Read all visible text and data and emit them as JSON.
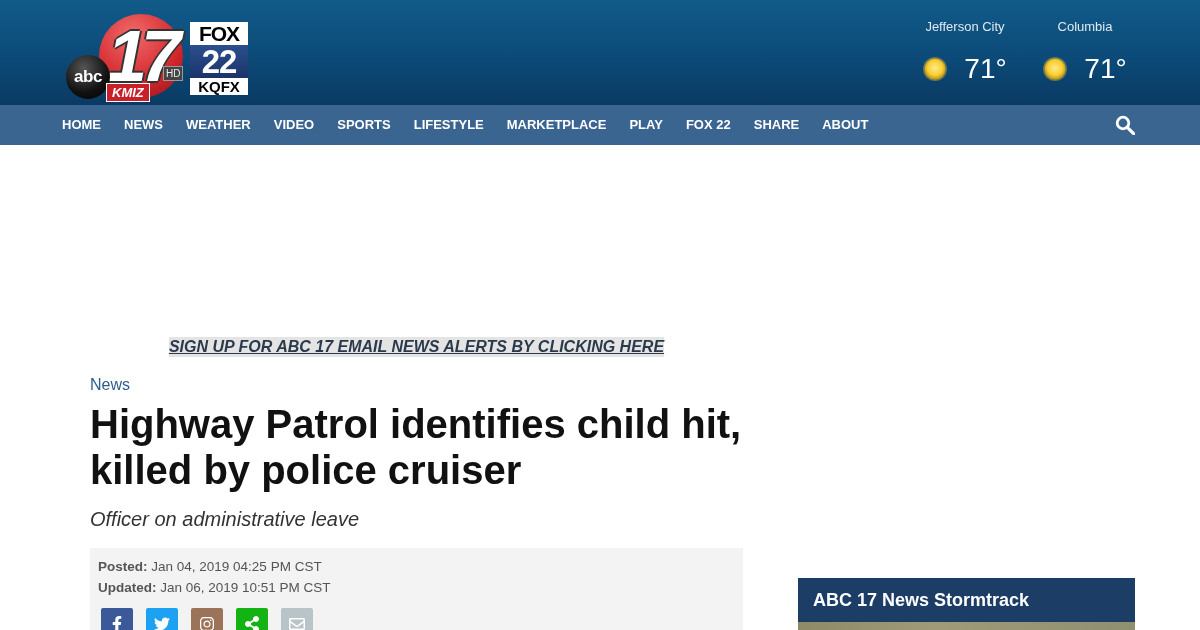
{
  "header": {
    "logo": {
      "network": "abc",
      "channel": "17",
      "hd": "HD",
      "call_sign": "KMIZ"
    },
    "partner_logo": {
      "network": "FOX",
      "channel": "22",
      "call_sign": "KQFX"
    },
    "weather": [
      {
        "city": "Jefferson City",
        "kind": "sunny",
        "temperature": "71°"
      },
      {
        "city": "Columbia",
        "kind": "sunny",
        "temperature": "71°"
      }
    ]
  },
  "nav": {
    "items": [
      "HOME",
      "NEWS",
      "WEATHER",
      "VIDEO",
      "SPORTS",
      "LIFESTYLE",
      "MARKETPLACE",
      "PLAY",
      "FOX 22",
      "SHARE",
      "ABOUT"
    ]
  },
  "promo_link": "SIGN UP FOR ABC 17 EMAIL NEWS ALERTS BY CLICKING HERE",
  "article": {
    "section": "News",
    "headline": "Highway Patrol identifies child hit, killed by police cruiser",
    "subheadline": "Officer on administrative leave",
    "dates": [
      {
        "label": "Posted:",
        "value": "Jan 04, 2019 04:25 PM CST"
      },
      {
        "label": "Updated:",
        "value": "Jan 06, 2019 10:51 PM CST"
      }
    ],
    "share_buttons": [
      {
        "kind": "facebook"
      },
      {
        "kind": "twitter"
      },
      {
        "kind": "instagram"
      },
      {
        "kind": "share"
      },
      {
        "kind": "email"
      }
    ]
  },
  "sidebar": {
    "widget_title": "ABC 17 News Stormtrack"
  }
}
